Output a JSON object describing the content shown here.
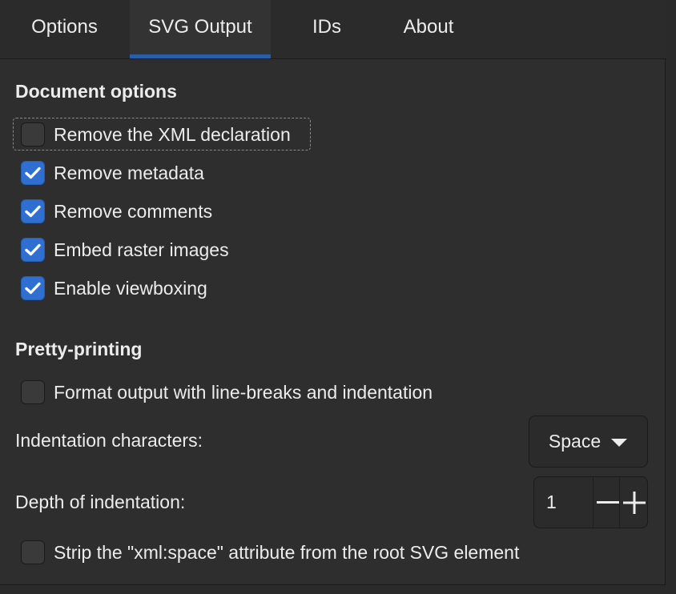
{
  "tabs": [
    {
      "label": "Options",
      "active": false
    },
    {
      "label": "SVG Output",
      "active": true
    },
    {
      "label": "IDs",
      "active": false
    },
    {
      "label": "About",
      "active": false
    }
  ],
  "document_options": {
    "heading": "Document options",
    "items": [
      {
        "label": "Remove the XML declaration",
        "checked": false,
        "focused": true
      },
      {
        "label": "Remove metadata",
        "checked": true
      },
      {
        "label": "Remove comments",
        "checked": true
      },
      {
        "label": "Embed raster images",
        "checked": true
      },
      {
        "label": "Enable viewboxing",
        "checked": true
      }
    ]
  },
  "pretty_printing": {
    "heading": "Pretty-printing",
    "format_output": {
      "label": "Format output with line-breaks and indentation",
      "checked": false
    },
    "indentation_characters": {
      "label": "Indentation characters:",
      "value": "Space"
    },
    "depth_of_indentation": {
      "label": "Depth of indentation:",
      "value": "1"
    },
    "strip_xml_space": {
      "label": "Strip the \"xml:space\" attribute from the root SVG element",
      "checked": false
    }
  },
  "colors": {
    "accent": "#2f6fd0",
    "background": "#2e2e2e",
    "text": "#ececec"
  }
}
